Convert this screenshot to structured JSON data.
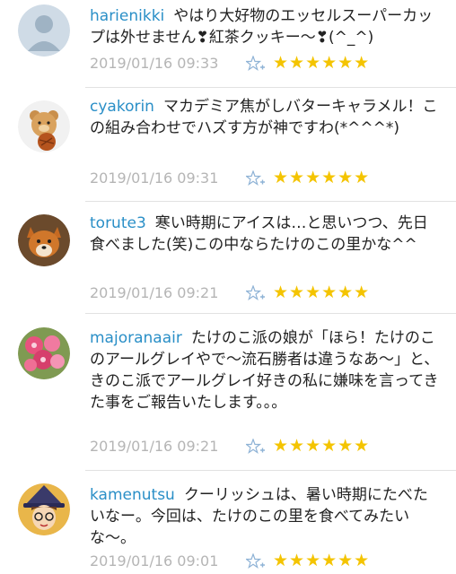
{
  "colors": {
    "username": "#2a8fc7",
    "star": "#f4c400",
    "meta": "#b5b5b5"
  },
  "comments": [
    {
      "user": "harienikki",
      "body": "やはり大好物のエッセルスーパーカップは外せません❣紅茶クッキー〜❣(^_^)",
      "time": "2019/01/16 09:33",
      "stars": "★★★★★★",
      "avatar_icon": "default-user-icon"
    },
    {
      "user": "cyakorin",
      "body": "マカデミア焦がしバターキャラメル！この組み合わせでハズす方が神ですわ(*^^^*)",
      "time": "2019/01/16 09:31",
      "stars": "★★★★★★",
      "avatar_icon": "teddy-bear-avatar"
    },
    {
      "user": "torute3",
      "body": "寒い時期にアイスは…と思いつつ、先日食べました(笑)この中ならたけのこの里かな^^",
      "time": "2019/01/16 09:21",
      "stars": "★★★★★★",
      "avatar_icon": "shiba-dog-avatar"
    },
    {
      "user": "majoranaair",
      "body": "たけのこ派の娘が「ほら！たけのこのアールグレイやで〜流石勝者は違うなあ〜」と、きのこ派でアールグレイ好きの私に嫌味を言ってきた事をご報告いたします。。。",
      "time": "2019/01/16 09:21",
      "stars": "★★★★★★",
      "avatar_icon": "pink-flowers-avatar"
    },
    {
      "user": "kamenutsu",
      "body": "クーリッシュは、暑い時期にたべたいなー。今回は、たけのこの里を食べてみたいな〜。",
      "time": "2019/01/16 09:01",
      "stars": "★★★★★★",
      "avatar_icon": "witch-avatar"
    }
  ]
}
